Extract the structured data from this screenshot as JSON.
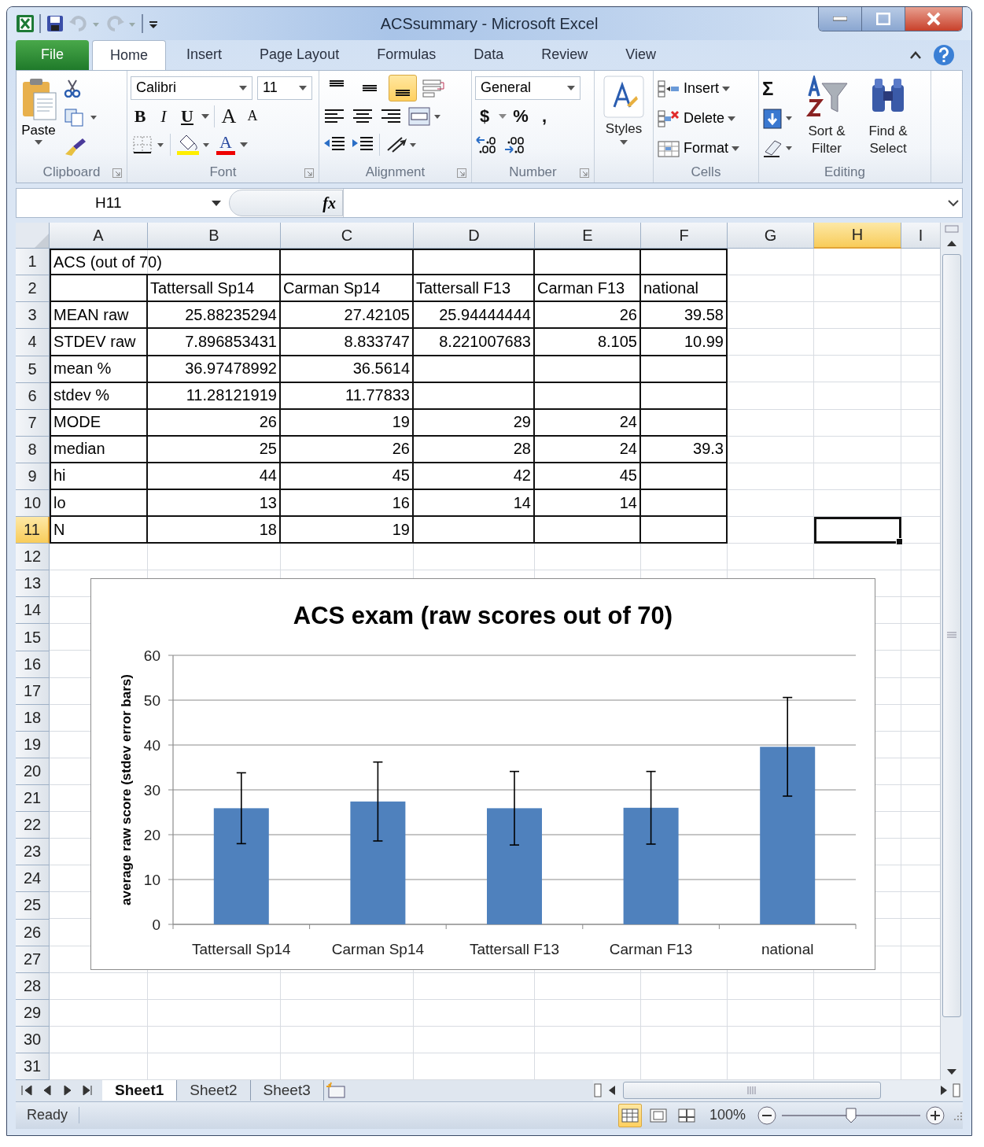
{
  "window": {
    "title": "ACSsummary  -  Microsoft Excel"
  },
  "ribbon_tabs": [
    {
      "label": "File",
      "selected": false,
      "kind": "file"
    },
    {
      "label": "Home",
      "selected": true,
      "kind": "tab"
    },
    {
      "label": "Insert",
      "selected": false,
      "kind": "tab"
    },
    {
      "label": "Page Layout",
      "selected": false,
      "kind": "tab"
    },
    {
      "label": "Formulas",
      "selected": false,
      "kind": "tab"
    },
    {
      "label": "Data",
      "selected": false,
      "kind": "tab"
    },
    {
      "label": "Review",
      "selected": false,
      "kind": "tab"
    },
    {
      "label": "View",
      "selected": false,
      "kind": "tab"
    }
  ],
  "ribbon": {
    "clipboard": {
      "label": "Clipboard",
      "paste": "Paste"
    },
    "font": {
      "label": "Font",
      "font_name": "Calibri",
      "font_size": "11",
      "bold": "B",
      "italic": "I",
      "underline": "U",
      "grow": "A",
      "shrink": "A",
      "font_color": "A"
    },
    "alignment": {
      "label": "Alignment",
      "buttons": [
        {
          "kind": "top",
          "selected": false
        },
        {
          "kind": "middle",
          "selected": false
        },
        {
          "kind": "bottom",
          "selected": true
        }
      ]
    },
    "number": {
      "label": "Number",
      "format": "General",
      "currency": "$",
      "percent": "%",
      "comma": ","
    },
    "styles": {
      "button": "Styles"
    },
    "cells": {
      "label": "Cells",
      "insert": "Insert",
      "delete": "Delete",
      "format": "Format"
    },
    "editing": {
      "label": "Editing",
      "sum": "Σ",
      "sort": "Sort & Filter",
      "find": "Find & Select"
    }
  },
  "formula_bar": {
    "name_box": "H11",
    "fx": "fx"
  },
  "columns": [
    {
      "label": "A",
      "selected": false
    },
    {
      "label": "B",
      "selected": false
    },
    {
      "label": "C",
      "selected": false
    },
    {
      "label": "D",
      "selected": false
    },
    {
      "label": "E",
      "selected": false
    },
    {
      "label": "F",
      "selected": false
    },
    {
      "label": "G",
      "selected": false
    },
    {
      "label": "H",
      "selected": true
    },
    {
      "label": "I",
      "selected": false
    }
  ],
  "rows": [
    {
      "number": "1",
      "selected": false,
      "cells": [
        "ACS (out of 70)",
        null,
        null,
        null,
        null,
        null
      ]
    },
    {
      "number": "2",
      "selected": false,
      "cells": [
        null,
        "Tattersall Sp14",
        "Carman Sp14",
        "Tattersall F13",
        "Carman F13",
        "national"
      ]
    },
    {
      "number": "3",
      "selected": false,
      "cells": [
        "MEAN raw",
        "25.88235294",
        "27.42105",
        "25.94444444",
        "26",
        "39.58"
      ]
    },
    {
      "number": "4",
      "selected": false,
      "cells": [
        "STDEV raw",
        "7.896853431",
        "8.833747",
        "8.221007683",
        "8.105",
        "10.99"
      ]
    },
    {
      "number": "5",
      "selected": false,
      "cells": [
        "mean %",
        "36.97478992",
        "36.5614",
        null,
        null,
        null
      ]
    },
    {
      "number": "6",
      "selected": false,
      "cells": [
        "stdev %",
        "11.28121919",
        "11.77833",
        null,
        null,
        null
      ]
    },
    {
      "number": "7",
      "selected": false,
      "cells": [
        "MODE",
        "26",
        "19",
        "29",
        "24",
        null
      ]
    },
    {
      "number": "8",
      "selected": false,
      "cells": [
        "median",
        "25",
        "26",
        "28",
        "24",
        "39.3"
      ]
    },
    {
      "number": "9",
      "selected": false,
      "cells": [
        "hi",
        "44",
        "45",
        "42",
        "45",
        null
      ]
    },
    {
      "number": "10",
      "selected": false,
      "cells": [
        "lo",
        "13",
        "16",
        "14",
        "14",
        null
      ]
    },
    {
      "number": "11",
      "selected": true,
      "cells": [
        "N",
        "18",
        "19",
        null,
        null,
        null
      ]
    },
    {
      "number": "12",
      "selected": false
    },
    {
      "number": "13",
      "selected": false
    },
    {
      "number": "14",
      "selected": false
    },
    {
      "number": "15",
      "selected": false
    },
    {
      "number": "16",
      "selected": false
    },
    {
      "number": "17",
      "selected": false
    },
    {
      "number": "18",
      "selected": false
    },
    {
      "number": "19",
      "selected": false
    },
    {
      "number": "20",
      "selected": false
    },
    {
      "number": "21",
      "selected": false
    },
    {
      "number": "22",
      "selected": false
    },
    {
      "number": "23",
      "selected": false
    },
    {
      "number": "24",
      "selected": false
    },
    {
      "number": "25",
      "selected": false
    },
    {
      "number": "26",
      "selected": false
    },
    {
      "number": "27",
      "selected": false
    },
    {
      "number": "28",
      "selected": false
    },
    {
      "number": "29",
      "selected": false
    },
    {
      "number": "30",
      "selected": false
    },
    {
      "number": "31",
      "selected": false
    }
  ],
  "chart": {
    "chart_data": {
      "type": "bar",
      "title": "ACS exam (raw scores out of 70)",
      "ylabel": "average  raw score  (stdev error bars)",
      "categories": [
        "Tattersall Sp14",
        "Carman Sp14",
        "Tattersall F13",
        "Carman F13",
        "national"
      ],
      "series": [
        {
          "color": "#4f81bd",
          "values": [
            25.9,
            27.4,
            25.9,
            26,
            39.6
          ],
          "errors": [
            7.9,
            8.8,
            8.2,
            8.1,
            11
          ]
        }
      ],
      "ylim": [
        0,
        60
      ],
      "yticks": [
        0,
        10,
        20,
        30,
        40,
        50,
        60
      ],
      "grid": true
    }
  },
  "sheet_tabs": [
    {
      "label": "Sheet1",
      "selected": true
    },
    {
      "label": "Sheet2",
      "selected": false
    },
    {
      "label": "Sheet3",
      "selected": false
    }
  ],
  "status_bar": {
    "status": "Ready",
    "zoom": "100%",
    "view_buttons": [
      {
        "kind": "normal",
        "selected": true
      },
      {
        "kind": "page_layout",
        "selected": false
      },
      {
        "kind": "page_break",
        "selected": false
      }
    ],
    "zoom_slider": {
      "level": 0.5
    }
  }
}
